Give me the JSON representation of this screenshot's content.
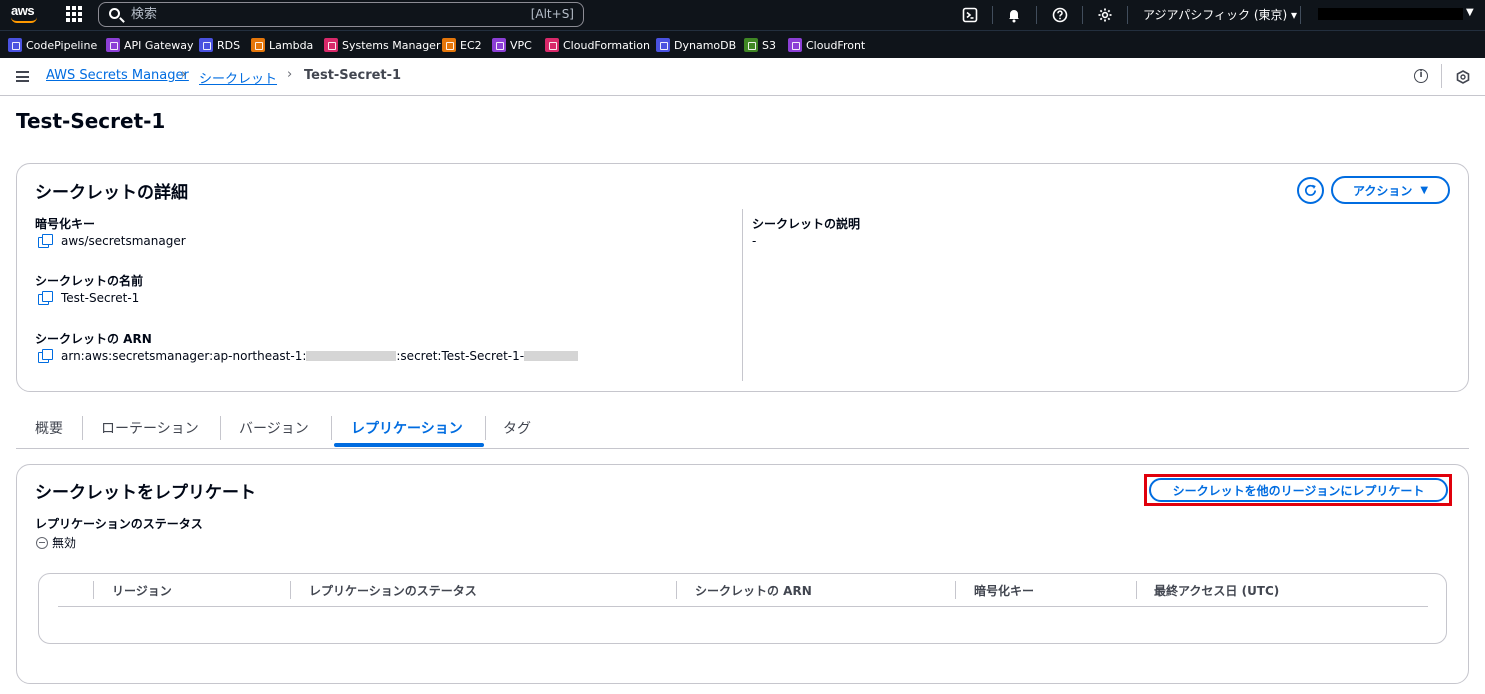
{
  "topbar": {
    "logo_text": "aws",
    "search_placeholder": "検索",
    "search_shortcut": "[Alt+S]",
    "region": "アジアパシフィック (東京) ▾"
  },
  "favorites": [
    {
      "label": "CodePipeline",
      "color": "#4a52e0"
    },
    {
      "label": "API Gateway",
      "color": "#8c3fd6"
    },
    {
      "label": "RDS",
      "color": "#4a52e0"
    },
    {
      "label": "Lambda",
      "color": "#e4760a"
    },
    {
      "label": "Systems Manager",
      "color": "#d8296a"
    },
    {
      "label": "EC2",
      "color": "#e4760a"
    },
    {
      "label": "VPC",
      "color": "#8c3fd6"
    },
    {
      "label": "CloudFormation",
      "color": "#d8296a"
    },
    {
      "label": "DynamoDB",
      "color": "#4a52e0"
    },
    {
      "label": "S3",
      "color": "#3f8624"
    },
    {
      "label": "CloudFront",
      "color": "#8c3fd6"
    }
  ],
  "breadcrumb": {
    "items": [
      "AWS Secrets Manager",
      "シークレット",
      "Test-Secret-1"
    ]
  },
  "page": {
    "title": "Test-Secret-1"
  },
  "details": {
    "title": "シークレットの詳細",
    "action_label": "アクション",
    "encryption_key_label": "暗号化キー",
    "encryption_key_value": "aws/secretsmanager",
    "name_label": "シークレットの名前",
    "name_value": "Test-Secret-1",
    "arn_label": "シークレットの ARN",
    "arn_prefix": "arn:aws:secretsmanager:ap-northeast-1:",
    "arn_middle": ":secret:Test-Secret-1-",
    "description_label": "シークレットの説明",
    "description_value": "-"
  },
  "tabs": [
    {
      "label": "概要",
      "active": false
    },
    {
      "label": "ローテーション",
      "active": false
    },
    {
      "label": "バージョン",
      "active": false
    },
    {
      "label": "レプリケーション",
      "active": true
    },
    {
      "label": "タグ",
      "active": false
    }
  ],
  "replication": {
    "title": "シークレットをレプリケート",
    "replicate_button": "シークレットを他のリージョンにレプリケート",
    "status_label": "レプリケーションのステータス",
    "status_value": "無効",
    "table_headers": [
      "リージョン",
      "レプリケーションのステータス",
      "シークレットの ARN",
      "暗号化キー",
      "最終アクセス日 (UTC)"
    ]
  },
  "colors": {
    "link": "#006ce0",
    "highlight": "#e0000c",
    "topbar": "#0f141a"
  }
}
